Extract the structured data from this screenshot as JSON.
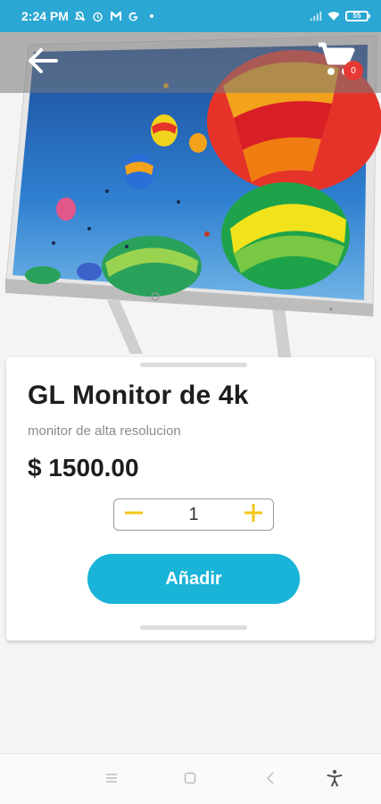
{
  "status_bar": {
    "time": "2:24 PM",
    "left_icons": [
      "muted-bell-icon",
      "alarm-icon",
      "gmail-icon",
      "google-icon",
      "dot-icon"
    ],
    "right_icons": [
      "signal-icon",
      "wifi-icon",
      "battery-icon"
    ],
    "battery_level": "55"
  },
  "top_bar": {
    "back_icon": "arrow-left-icon",
    "cart_icon": "shopping-cart-icon",
    "cart_count": "0"
  },
  "product": {
    "title": "GL Monitor de 4k",
    "description": "monitor de alta resolucion",
    "price": "$ 1500.00",
    "quantity": "1",
    "add_label": "Añadir"
  },
  "nav_bar": {
    "items": [
      "menu-icon",
      "home-icon",
      "back-icon",
      "accessibility-icon"
    ]
  },
  "colors": {
    "status_bar": "#2aa7d3",
    "accent": "#19b4d8",
    "stepper_icons": "#f5c518",
    "badge": "#e53935"
  }
}
